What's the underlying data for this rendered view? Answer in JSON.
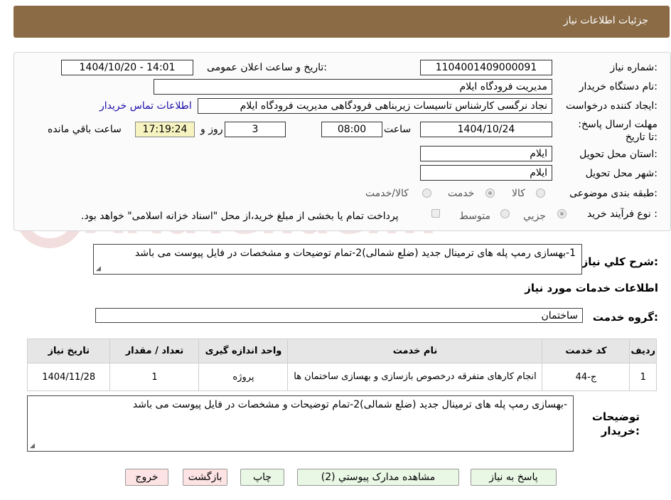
{
  "header": {
    "title": "جزئیات اطلاعات نیاز"
  },
  "form": {
    "need_number": {
      "label": "شماره نیاز:",
      "value": "1104001409000091"
    },
    "announce_datetime": {
      "label": "تاریخ و ساعت اعلان عمومی:",
      "value": "1404/10/20 - 14:01"
    },
    "buyer_org": {
      "label": "نام دستگاه خریدار:",
      "value": "مدیریت فرودگاه ایلام"
    },
    "requester": {
      "label": "ایجاد کننده درخواست:",
      "value": "نجاد نرگسی کارشناس تاسیسات زیربناهی فرودگاهی مدیریت فرودگاه ایلام"
    },
    "buyer_contact_link": "اطلاعات تماس خریدار",
    "deadline": {
      "label": "مهلت ارسال پاسخ: تا تاریخ:",
      "date": "1404/10/24",
      "time_label": "ساعت",
      "time": "08:00",
      "days": "3",
      "days_label": "روز و",
      "remaining_time": "17:19:24",
      "remaining_label": "ساعت باقي مانده"
    },
    "delivery_province": {
      "label": "استان محل تحویل:",
      "value": "ایلام"
    },
    "delivery_city": {
      "label": "شهر محل تحویل:",
      "value": "ایلام"
    },
    "category": {
      "label": "طبقه بندی موضوعی:",
      "options": [
        "کالا",
        "خدمت",
        "کالا/خدمت"
      ],
      "selected": "خدمت"
    },
    "purchase_type": {
      "label": "نوع فرآیند خرید :",
      "options": [
        "جزیي",
        "متوسط"
      ],
      "selected": "جزیي",
      "treasury_note": "پرداخت تمام یا بخشی از مبلغ خرید،از محل \"اسناد خزانه اسلامی\" خواهد بود."
    }
  },
  "summary": {
    "label": "شرح کلي نیاز:",
    "value": "1-بهسازی رمپ پله های ترمینال جدید (ضلع شمالی)2-تمام توضیحات و مشخصات در فایل پیوست می باشد"
  },
  "services_section": {
    "title": "اطلاعات خدمات مورد نیاز",
    "group_label": "گروه خدمت:",
    "group_value": "ساختمان"
  },
  "table": {
    "headers": [
      "ردیف",
      "کد خدمت",
      "نام خدمت",
      "واحد اندازه گیری",
      "تعداد / مقدار",
      "تاریخ نیاز"
    ],
    "rows": [
      [
        "1",
        "ج-44",
        "انجام کارهای متفرقه درخصوص بازسازی و بهسازی ساختمان ها",
        "پروژه",
        "1",
        "1404/11/28"
      ]
    ]
  },
  "buyer_notes": {
    "label": "توضیحات خریدار:",
    "value": "-بهسازی رمپ پله های ترمینال جدید (ضلع شمالی)2-تمام توضیحات و مشخصات در فایل پیوست می باشد"
  },
  "buttons": {
    "reply": "پاسخ به نیاز",
    "attachments": "مشاهده مدارک پیوستي (2)",
    "print": "چاپ",
    "back": "بازگشت",
    "exit": "خروج"
  },
  "colors": {
    "header_bg": "#8a6b46",
    "button_green": "#e9f7e5",
    "button_red": "#fde3e3",
    "timer_bg": "#f7f3c0"
  },
  "watermark": "AriaTender.neT"
}
